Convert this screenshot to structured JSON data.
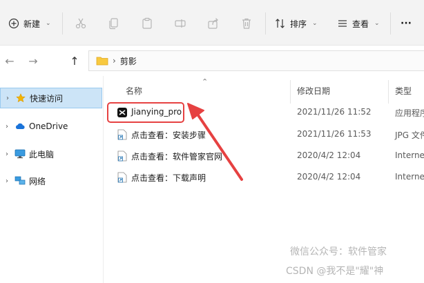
{
  "toolbar": {
    "new_label": "新建",
    "sort_label": "排序",
    "view_label": "查看",
    "more_label": "···"
  },
  "address": {
    "path": "剪影"
  },
  "sidebar": {
    "items": [
      {
        "label": "快速访问",
        "icon": "star-icon"
      },
      {
        "label": "OneDrive",
        "icon": "cloud-icon"
      },
      {
        "label": "此电脑",
        "icon": "monitor-icon"
      },
      {
        "label": "网络",
        "icon": "network-icon"
      }
    ]
  },
  "columns": {
    "name": "名称",
    "date": "修改日期",
    "type": "类型"
  },
  "files": [
    {
      "name": "Jianying_pro",
      "date": "2021/11/26 11:52",
      "type": "应用程序",
      "icon": "capcut-app-icon"
    },
    {
      "name": "点击查看：安装步骤",
      "date": "2021/11/26 11:53",
      "type": "JPG 文件",
      "icon": "shortcut-icon"
    },
    {
      "name": "点击查看：软件管家官网",
      "date": "2020/4/2 12:04",
      "type": "Internet",
      "icon": "shortcut-icon"
    },
    {
      "name": "点击查看：下载声明",
      "date": "2020/4/2 12:04",
      "type": "Internet",
      "icon": "shortcut-icon"
    }
  ],
  "watermark": {
    "line1": "微信公众号：软件管家",
    "line2": "CSDN @我不是\"耀\"神"
  },
  "colors": {
    "accent_red": "#e64141",
    "selection": "#cce4f7"
  }
}
